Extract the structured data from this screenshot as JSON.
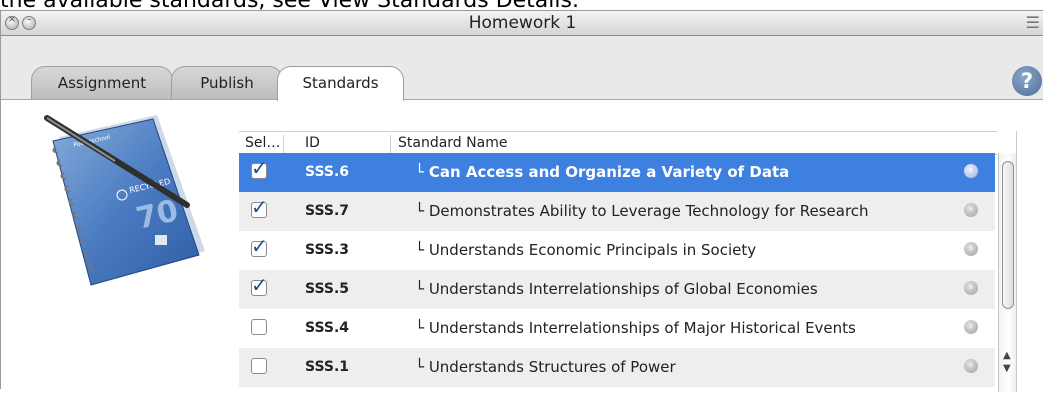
{
  "caption": "the available standards, see View Standards Details.",
  "window": {
    "title": "Homework 1",
    "controls": [
      "close-icon",
      "minimize-icon"
    ],
    "menu_icon": "list-icon"
  },
  "tabs": [
    {
      "label": "Assignment",
      "active": false
    },
    {
      "label": "Publish",
      "active": false
    },
    {
      "label": "Standards",
      "active": true
    }
  ],
  "help": {
    "label": "?"
  },
  "notebook": {
    "icon": "spiral-notebook-icon",
    "brand": "Powerschool",
    "label": "RECYCLED",
    "number": "70"
  },
  "table": {
    "columns": [
      "Sel…",
      "ID",
      "Standard Name"
    ],
    "rows": [
      {
        "selected": true,
        "checked": true,
        "id": "SSS.6",
        "name": "Can Access and Organize a Variety of Data"
      },
      {
        "selected": false,
        "checked": true,
        "id": "SSS.7",
        "name": "Demonstrates Ability to Leverage Technology for Research"
      },
      {
        "selected": false,
        "checked": true,
        "id": "SSS.3",
        "name": "Understands Economic Principals in Society"
      },
      {
        "selected": false,
        "checked": true,
        "id": "SSS.5",
        "name": "Understands Interrelationships of Global Economies"
      },
      {
        "selected": false,
        "checked": false,
        "id": "SSS.4",
        "name": "Understands Interrelationships of Major Historical Events"
      },
      {
        "selected": false,
        "checked": false,
        "id": "SSS.1",
        "name": "Understands Structures of Power"
      }
    ],
    "tree_prefix": "└ "
  },
  "colors": {
    "selection": "#3d80df",
    "check": "#1f4f8d"
  }
}
